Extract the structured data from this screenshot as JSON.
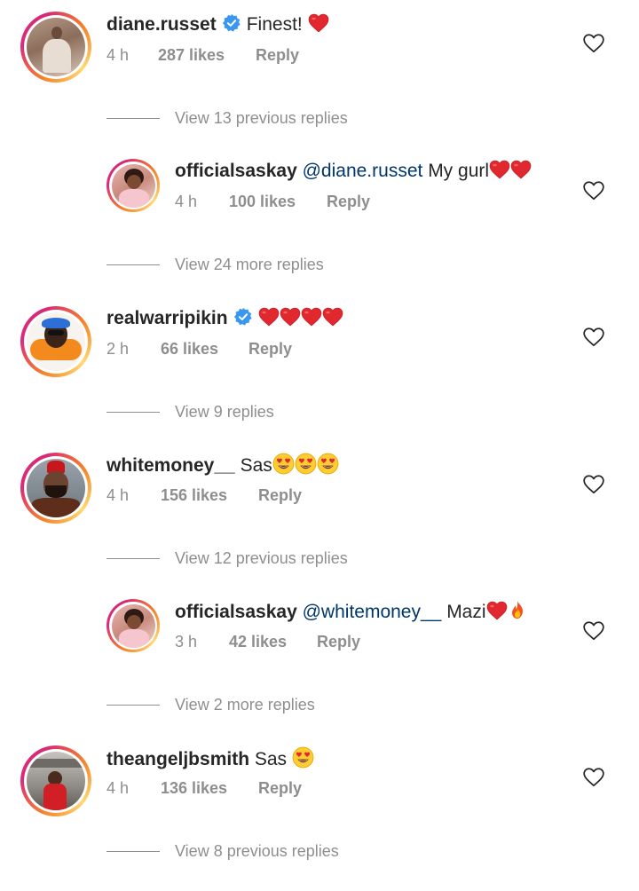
{
  "comments": [
    {
      "username": "diane.russet",
      "verified": true,
      "mention": "",
      "text": "Finest!",
      "emoji": "heart",
      "time": "4 h",
      "likes": "287 likes",
      "reply": "Reply"
    },
    {
      "username": "officialsaskay",
      "verified": false,
      "mention": "@diane.russet",
      "text": "My gurl",
      "emoji": "heart-heart",
      "time": "4 h",
      "likes": "100 likes",
      "reply": "Reply"
    },
    {
      "username": "realwarripikin",
      "verified": true,
      "mention": "",
      "text": "",
      "emoji": "heart-x4",
      "time": "2 h",
      "likes": "66 likes",
      "reply": "Reply"
    },
    {
      "username": "whitemoney__",
      "verified": false,
      "mention": "",
      "text": "Sas",
      "emoji": "heart-eyes-x3",
      "time": "4 h",
      "likes": "156 likes",
      "reply": "Reply"
    },
    {
      "username": "officialsaskay",
      "verified": false,
      "mention": "@whitemoney__",
      "text": "Mazi",
      "emoji": "heart-fire",
      "time": "3 h",
      "likes": "42 likes",
      "reply": "Reply"
    },
    {
      "username": "theangeljbsmith",
      "verified": false,
      "mention": "",
      "text": "Sas",
      "emoji": "heart-eyes",
      "time": "4 h",
      "likes": "136 likes",
      "reply": "Reply"
    }
  ],
  "view_links": [
    "View 13 previous replies",
    "View 24 more replies",
    "View 9 replies",
    "View 12 previous replies",
    "View 2 more replies",
    "View 8 previous replies"
  ],
  "icons": {
    "verified": "verified-badge-icon",
    "like": "heart-outline-icon"
  },
  "colors": {
    "username": "#262626",
    "mention": "#00376b",
    "meta": "#8e8e8e",
    "verified": "#3897f0",
    "heart_emoji": "#e0282e"
  }
}
